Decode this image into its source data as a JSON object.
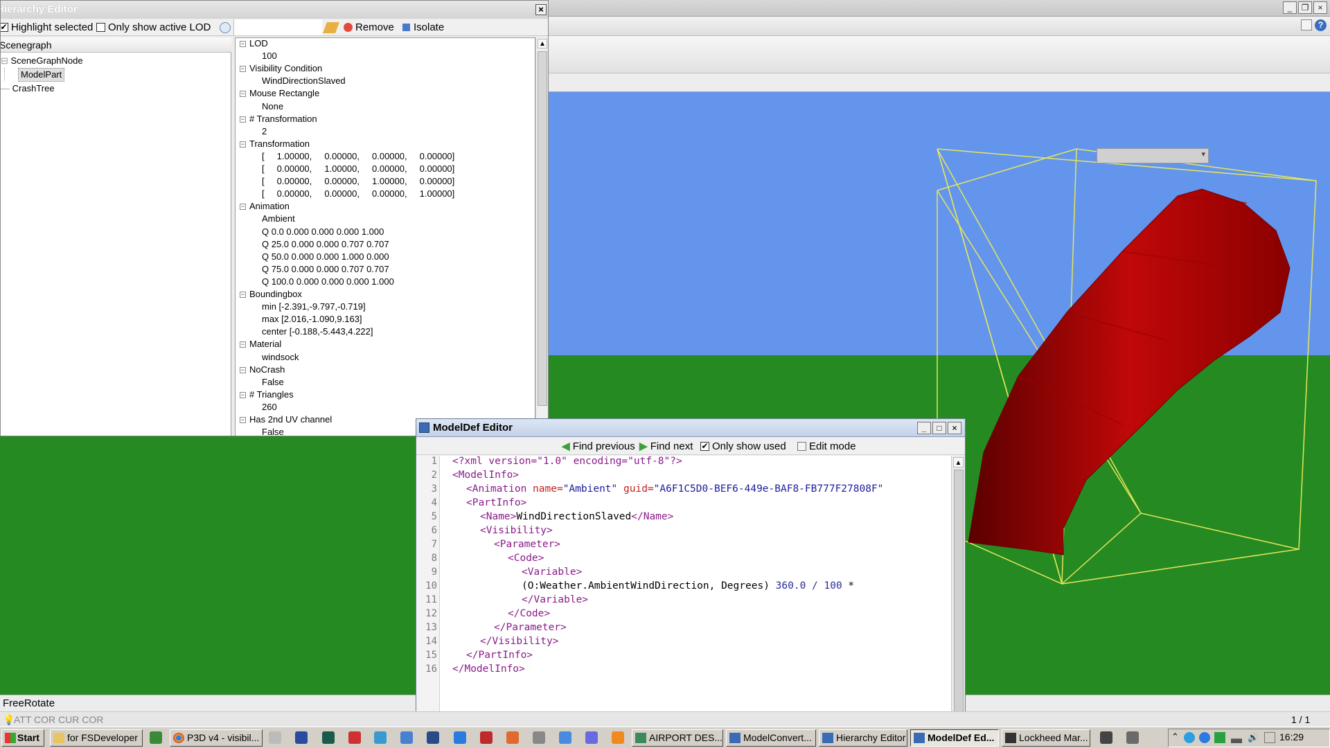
{
  "hierarchy_editor": {
    "title": "Hierarchy Editor",
    "highlight_selected": "Highlight selected",
    "only_active_lod": "Only show active LOD",
    "remove": "Remove",
    "isolate": "Isolate",
    "scenegraph_header": "Scenegraph",
    "tree": [
      "SceneGraphNode",
      "ModelPart",
      "CrashTree"
    ],
    "properties": [
      {
        "name": "LOD",
        "values": [
          "100"
        ]
      },
      {
        "name": "Visibility Condition",
        "values": [
          "WindDirectionSlaved"
        ]
      },
      {
        "name": "Mouse Rectangle",
        "values": [
          "None"
        ]
      },
      {
        "name": "# Transformation",
        "values": [
          "2"
        ]
      },
      {
        "name": "Transformation",
        "values": [
          "[     1.00000,     0.00000,     0.00000,     0.00000]",
          "[     0.00000,     1.00000,     0.00000,     0.00000]",
          "[     0.00000,     0.00000,     1.00000,     0.00000]",
          "[     0.00000,     0.00000,     0.00000,     1.00000]"
        ]
      },
      {
        "name": "Animation",
        "values": [
          "Ambient",
          "Q 0.0 0.000 0.000 0.000 1.000",
          "Q 25.0 0.000 0.000 0.707 0.707",
          "Q 50.0 0.000 0.000 1.000 0.000",
          "Q 75.0 0.000 0.000 0.707 0.707",
          "Q 100.0 0.000 0.000 0.000 1.000"
        ]
      },
      {
        "name": "Boundingbox",
        "values": [
          "min [-2.391,-9.797,-0.719]",
          "max [2.016,-1.090,9.163]",
          "center [-0.188,-5.443,4.222]"
        ]
      },
      {
        "name": "Material",
        "values": [
          "windsock"
        ]
      },
      {
        "name": "NoCrash",
        "values": [
          "False"
        ]
      },
      {
        "name": "# Triangles",
        "values": [
          "260"
        ]
      },
      {
        "name": "Has 2nd UV channel",
        "values": [
          "False"
        ]
      }
    ]
  },
  "modeldef_editor": {
    "title": "ModelDef Editor",
    "find_previous": "Find previous",
    "find_next": "Find next",
    "only_show_used": "Only show used",
    "edit_mode": "Edit mode",
    "line_numbers": [
      "1",
      "2",
      "3",
      "4",
      "5",
      "6",
      "7",
      "8",
      "9",
      "10",
      "11",
      "12",
      "13",
      "14",
      "15",
      "16"
    ],
    "code": {
      "l1": "<?xml version=\"1.0\" encoding=\"utf-8\"?>",
      "l2": "<ModelInfo>",
      "l3_tag": "<Animation",
      "l3_a1": " name=",
      "l3_v1": "\"Ambient\"",
      "l3_a2": " guid=",
      "l3_v2": "\"A6F1C5D0-BEF6-449e-BAF8-FB777F27808F\"",
      "l4": "<PartInfo>",
      "l5_open": "<Name>",
      "l5_text": "WindDirectionSlaved",
      "l5_close": "</Name>",
      "l6": "<Visibility>",
      "l7": "<Parameter>",
      "l8": "<Code>",
      "l9": "<Variable>",
      "l10_text": "(O:Weather.AmbientWindDirection, Degrees) ",
      "l10_num": "360.0 / 100",
      "l10_end": " *",
      "l11": "</Variable>",
      "l12": "</Code>",
      "l13": "</Parameter>",
      "l14": "</Visibility>",
      "l15": "</PartInfo>",
      "l16": "</ModelInfo>"
    }
  },
  "status": {
    "mode": "FreeRotate",
    "indicators": "ATT COR  CUR COR",
    "page": "1 / 1"
  },
  "taskbar": {
    "start": "Start",
    "buttons": [
      "for FSDeveloper",
      "P3D v4 - visibil...",
      "AIRPORT DES...",
      "ModelConvert...",
      "Hierarchy Editor",
      "ModelDef Ed...",
      "Lockheed Mar..."
    ],
    "clock": "16:29"
  },
  "colors": {
    "sky": "#6495ec",
    "ground": "#258a22",
    "windsock": "#c00000",
    "bbox": "#e6e65a"
  }
}
